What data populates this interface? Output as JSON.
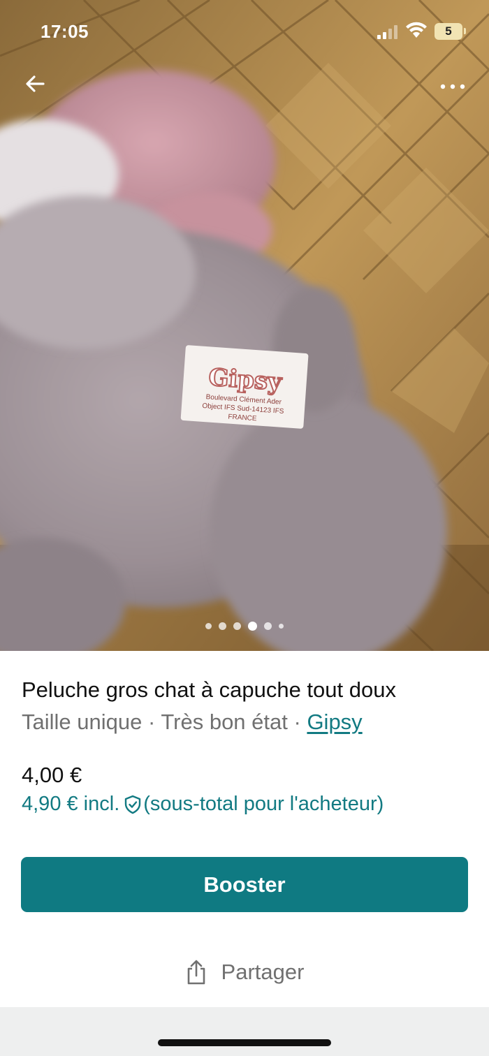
{
  "status_bar": {
    "time": "17:05",
    "battery_level": "5"
  },
  "nav": {
    "back_icon": "arrow-left-icon",
    "more_icon": "more-horizontal-icon"
  },
  "photo": {
    "label_text": "Gipsy",
    "label_line1": "Boulevard Clément Ader",
    "label_line2": "Object IFS Sud-14123 IFS",
    "label_line3": "FRANCE",
    "carousel_count": 6,
    "carousel_active_index": 3
  },
  "item": {
    "title": "Peluche gros chat à capuche tout doux",
    "size": "Taille unique",
    "separator": " · ",
    "condition": "Très bon état",
    "brand": "Gipsy",
    "price": "4,00 €",
    "buyer_price": "4,90 € incl.",
    "buyer_note": "(sous-total pour l'acheteur)"
  },
  "actions": {
    "booster_label": "Booster",
    "share_label": "Partager"
  },
  "colors": {
    "accent": "#0f7a82",
    "link": "#127a82",
    "muted_text": "#707070"
  }
}
